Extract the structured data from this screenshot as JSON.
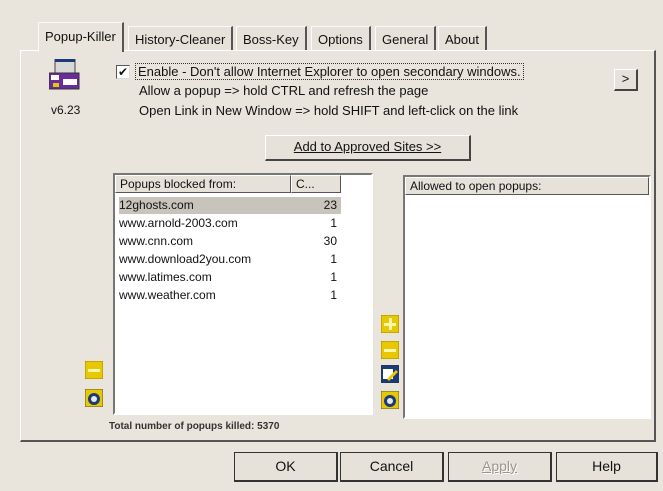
{
  "tabs": [
    {
      "label": "Popup-Killer",
      "active": true
    },
    {
      "label": "History-Cleaner",
      "active": false
    },
    {
      "label": "Boss-Key",
      "active": false
    },
    {
      "label": "Options",
      "active": false
    },
    {
      "label": "General",
      "active": false
    },
    {
      "label": "About",
      "active": false
    }
  ],
  "app": {
    "version": "v6.23",
    "icon": "popup-killer-app-icon"
  },
  "enable": {
    "checked": true,
    "check_mark": "✔",
    "label": "Enable - Don't allow Internet Explorer to open secondary windows."
  },
  "info": {
    "line1": "Allow a popup => hold CTRL and refresh the page",
    "line2": "Open Link in New Window => hold SHIFT and left-click on the link"
  },
  "more_button": ">",
  "add_approved_label": "Add to Approved Sites >>",
  "blocked_list": {
    "header_site": "Popups blocked from:",
    "header_count": "C...",
    "rows": [
      {
        "site": "12ghosts.com",
        "count": "23"
      },
      {
        "site": "www.arnold-2003.com",
        "count": "1"
      },
      {
        "site": "www.cnn.com",
        "count": "30"
      },
      {
        "site": "www.download2you.com",
        "count": "1"
      },
      {
        "site": "www.latimes.com",
        "count": "1"
      },
      {
        "site": "www.weather.com",
        "count": "1"
      }
    ]
  },
  "allowed_list": {
    "header": "Allowed to open popups:",
    "rows": []
  },
  "total_killed": "Total number of popups killed: 5370",
  "buttons": {
    "ok": "OK",
    "cancel": "Cancel",
    "apply": "Apply",
    "help": "Help"
  },
  "colors": {
    "face": "#e9e5dc",
    "icon_yellow": "#e8c800",
    "icon_blue": "#1a3a7a"
  }
}
